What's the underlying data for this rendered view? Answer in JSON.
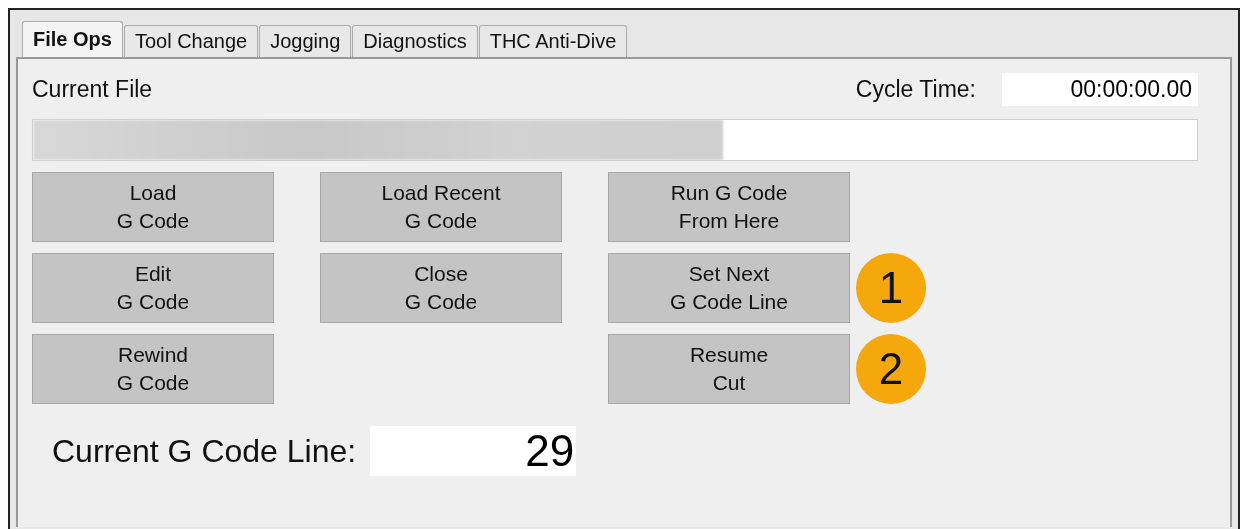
{
  "tabs": [
    {
      "label": "File Ops",
      "selected": true
    },
    {
      "label": "Tool Change",
      "selected": false
    },
    {
      "label": "Jogging",
      "selected": false
    },
    {
      "label": "Diagnostics",
      "selected": false
    },
    {
      "label": "THC Anti-Dive",
      "selected": false
    }
  ],
  "current_file": {
    "label": "Current File",
    "path": {
      "kind": "blurred"
    }
  },
  "cycle_time": {
    "label": "Cycle Time:",
    "value": "00:00:00.00"
  },
  "button_rows": [
    {
      "buttons": [
        {
          "label": "Load\nG Code"
        },
        {
          "label": "Load Recent\nG Code"
        },
        {
          "label": "Run G Code\nFrom Here"
        }
      ]
    },
    {
      "buttons": [
        {
          "label": "Edit\nG Code"
        },
        {
          "label": "Close\nG Code"
        },
        {
          "label": "Set Next\nG Code Line"
        }
      ],
      "badge": "1"
    },
    {
      "buttons": [
        {
          "label": "Rewind\nG Code"
        },
        {
          "kind": "spacer"
        },
        {
          "label": "Resume\nCut"
        }
      ],
      "badge": "2"
    }
  ],
  "current_line": {
    "label": "Current G Code Line:",
    "value": "29"
  }
}
